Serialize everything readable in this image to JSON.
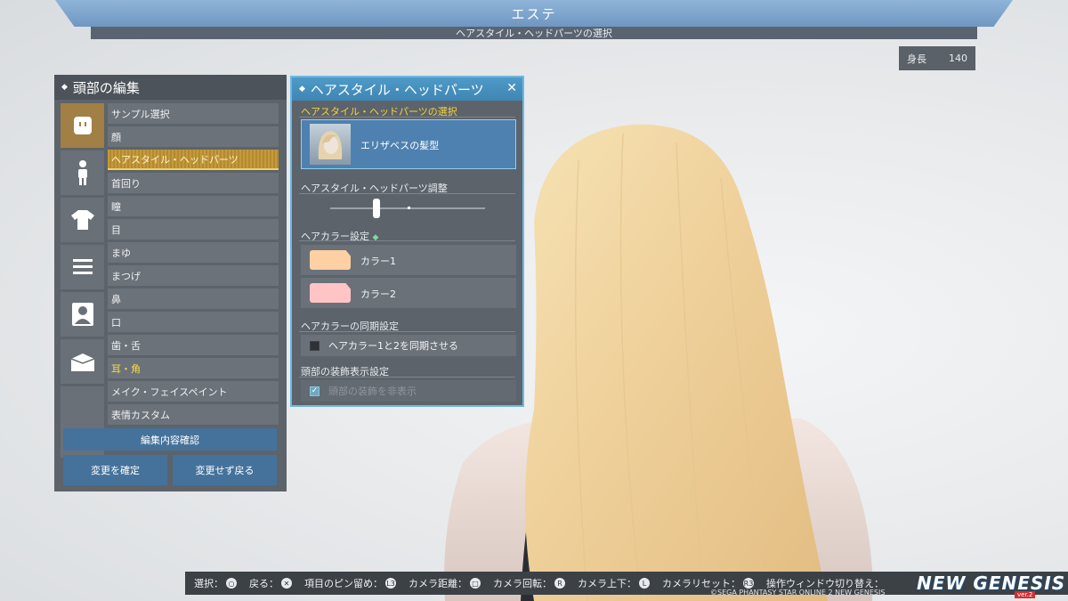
{
  "header": {
    "title": "エステ",
    "subtitle": "ヘアスタイル・ヘッドパーツの選択"
  },
  "height_badge": {
    "label": "身長",
    "value": "140"
  },
  "left_panel": {
    "title": "頭部の編集",
    "categories": [
      {
        "icon": "face-icon",
        "active": true
      },
      {
        "icon": "body-icon",
        "active": false
      },
      {
        "icon": "shirt-icon",
        "active": false
      },
      {
        "icon": "menu-lines-icon",
        "active": false
      },
      {
        "icon": "portrait-icon",
        "active": false
      },
      {
        "icon": "box-icon",
        "active": false
      }
    ],
    "menu_items": [
      {
        "label": "サンプル選択",
        "state": "normal"
      },
      {
        "label": "顔",
        "state": "normal"
      },
      {
        "label": "ヘアスタイル・ヘッドパーツ",
        "state": "selected"
      },
      {
        "label": "首回り",
        "state": "normal"
      },
      {
        "label": "瞳",
        "state": "normal"
      },
      {
        "label": "目",
        "state": "normal"
      },
      {
        "label": "まゆ",
        "state": "normal"
      },
      {
        "label": "まつげ",
        "state": "normal"
      },
      {
        "label": "鼻",
        "state": "normal"
      },
      {
        "label": "口",
        "state": "normal"
      },
      {
        "label": "歯・舌",
        "state": "normal"
      },
      {
        "label": "耳・角",
        "state": "highlight"
      },
      {
        "label": "メイク・フェイスペイント",
        "state": "normal"
      },
      {
        "label": "表情カスタム",
        "state": "normal"
      }
    ],
    "confirm_edit": "編集内容確認",
    "apply": "変更を確定",
    "back_without_change": "変更せず戻る"
  },
  "hair_panel": {
    "title": "ヘアスタイル・ヘッドパーツ",
    "close_glyph": "✕",
    "select_label": "ヘアスタイル・ヘッドパーツの選択",
    "selected_hairstyle": "エリザベスの髪型",
    "adjust_label": "ヘアスタイル・ヘッドパーツ調整",
    "adjust_value": 0.3,
    "color_label": "ヘアカラー設定",
    "colors": [
      {
        "label": "カラー1",
        "hex": "#ffd0a4"
      },
      {
        "label": "カラー2",
        "hex": "#ffc4c6"
      }
    ],
    "sync_label": "ヘアカラーの同期設定",
    "sync_option": "ヘアカラー1と2を同期させる",
    "sync_checked": false,
    "deco_label": "頭部の装飾表示設定",
    "deco_option": "頭部の装飾を非表示",
    "deco_checked": true
  },
  "bottom_hints": [
    {
      "label": "選択：",
      "glyph": "○"
    },
    {
      "label": "戻る：",
      "glyph": "✕"
    },
    {
      "label": "項目のピン留め：",
      "glyph": "L3"
    },
    {
      "label": "カメラ距離：",
      "glyph": "□"
    },
    {
      "label": "カメラ回転：",
      "glyph": "R"
    },
    {
      "label": "カメラ上下：",
      "glyph": "L"
    },
    {
      "label": "カメラリセット：",
      "glyph": "R3"
    },
    {
      "label": "操作ウィンドウ切り替え：",
      "glyph": ""
    }
  ],
  "copyright": "©SEGA PHANTASY STAR ONLINE 2 NEW GENESIS",
  "logo": "NEW GENESIS",
  "logo_sub": "ver.2"
}
